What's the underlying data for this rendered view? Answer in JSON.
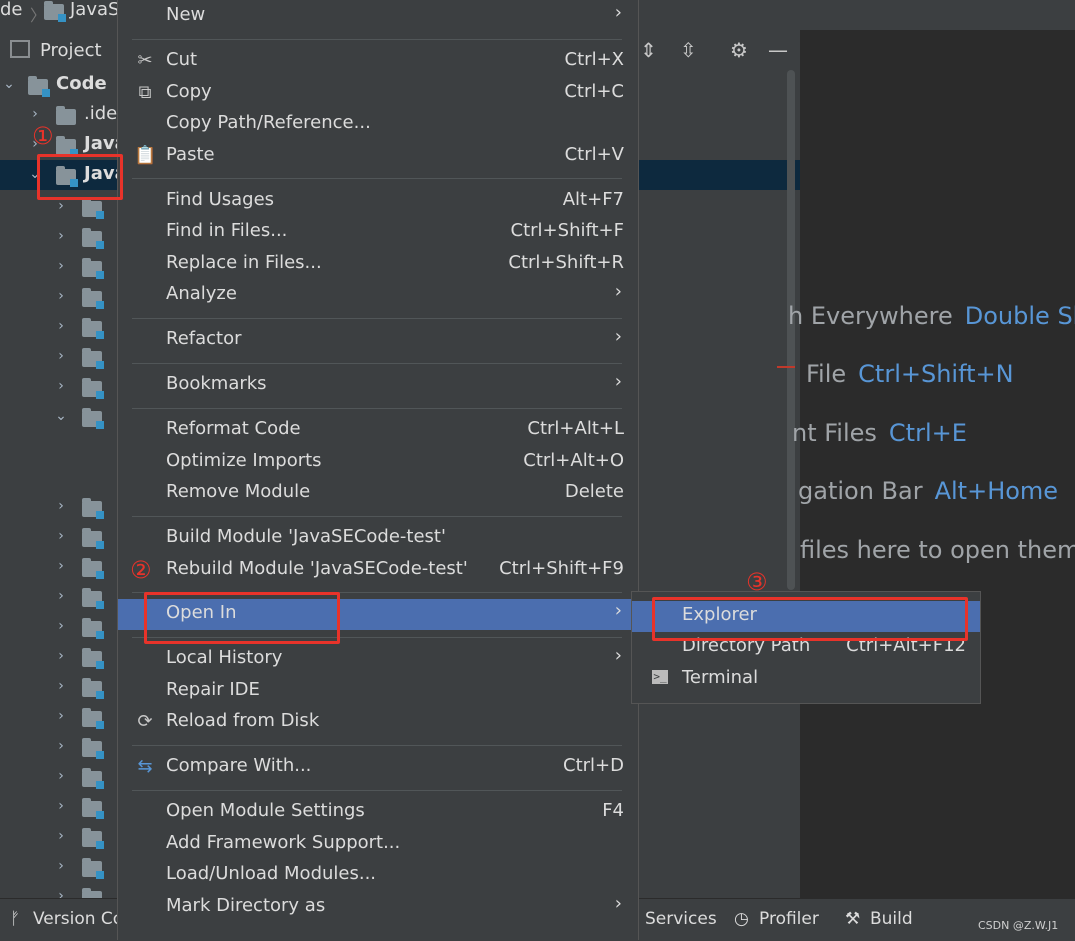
{
  "breadcrumb": {
    "part1": "de",
    "part2": "JavaS"
  },
  "project_panel": {
    "title": "Project",
    "root_label": "Code",
    "rows": [
      ".ide",
      "Java",
      "Java"
    ],
    "toolbar_icons": [
      "expand-all-icon",
      "collapse-all-icon",
      "gear-icon",
      "minimize-icon"
    ]
  },
  "context_menu": {
    "items": [
      {
        "label": "New",
        "shortcut": "",
        "submenu": true
      },
      {
        "label": "Cut",
        "shortcut": "Ctrl+X",
        "icon": "scissors-icon"
      },
      {
        "label": "Copy",
        "shortcut": "Ctrl+C",
        "icon": "copy-icon"
      },
      {
        "label": "Copy Path/Reference...",
        "shortcut": ""
      },
      {
        "label": "Paste",
        "shortcut": "Ctrl+V",
        "icon": "clipboard-icon"
      },
      {
        "label": "Find Usages",
        "shortcut": "Alt+F7"
      },
      {
        "label": "Find in Files...",
        "shortcut": "Ctrl+Shift+F"
      },
      {
        "label": "Replace in Files...",
        "shortcut": "Ctrl+Shift+R"
      },
      {
        "label": "Analyze",
        "shortcut": "",
        "submenu": true
      },
      {
        "label": "Refactor",
        "shortcut": "",
        "submenu": true
      },
      {
        "label": "Bookmarks",
        "shortcut": "",
        "submenu": true
      },
      {
        "label": "Reformat Code",
        "shortcut": "Ctrl+Alt+L"
      },
      {
        "label": "Optimize Imports",
        "shortcut": "Ctrl+Alt+O"
      },
      {
        "label": "Remove Module",
        "shortcut": "Delete"
      },
      {
        "label": "Build Module 'JavaSECode-test'",
        "shortcut": ""
      },
      {
        "label": "Rebuild Module 'JavaSECode-test'",
        "shortcut": "Ctrl+Shift+F9"
      },
      {
        "label": "Open In",
        "shortcut": "",
        "submenu": true,
        "selected": true
      },
      {
        "label": "Local History",
        "shortcut": "",
        "submenu": true
      },
      {
        "label": "Repair IDE",
        "shortcut": ""
      },
      {
        "label": "Reload from Disk",
        "shortcut": "",
        "icon": "reload-icon"
      },
      {
        "label": "Compare With...",
        "shortcut": "Ctrl+D",
        "icon": "compare-icon"
      },
      {
        "label": "Open Module Settings",
        "shortcut": "F4"
      },
      {
        "label": "Add Framework Support...",
        "shortcut": ""
      },
      {
        "label": "Load/Unload Modules...",
        "shortcut": ""
      },
      {
        "label": "Mark Directory as",
        "shortcut": "",
        "submenu": true
      }
    ]
  },
  "submenu": {
    "items": [
      {
        "label": "Explorer",
        "shortcut": "",
        "selected": true
      },
      {
        "label": "Directory Path",
        "shortcut": "Ctrl+Alt+F12"
      },
      {
        "label": "Terminal",
        "shortcut": "",
        "icon": "terminal-icon"
      }
    ]
  },
  "editor_hints": [
    {
      "text": "h Everywhere",
      "key": "Double Sh"
    },
    {
      "text": "File",
      "key": "Ctrl+Shift+N"
    },
    {
      "text": "nt Files",
      "key": "Ctrl+E"
    },
    {
      "text": "gation Bar",
      "key": "Alt+Home"
    },
    {
      "text": "files here to open them",
      "key": ""
    }
  ],
  "annotations": {
    "step1": "①",
    "step2": "②",
    "step3": "③",
    "color": "#e8332a"
  },
  "statusbar": {
    "version_control": "Version Co",
    "services": "Services",
    "profiler": "Profiler",
    "build": "Build",
    "watermark": "CSDN @Z.W.J1"
  },
  "colors": {
    "menu_bg": "#3c3f41",
    "selected": "#4b6eaf",
    "link_blue": "#5896d6"
  }
}
